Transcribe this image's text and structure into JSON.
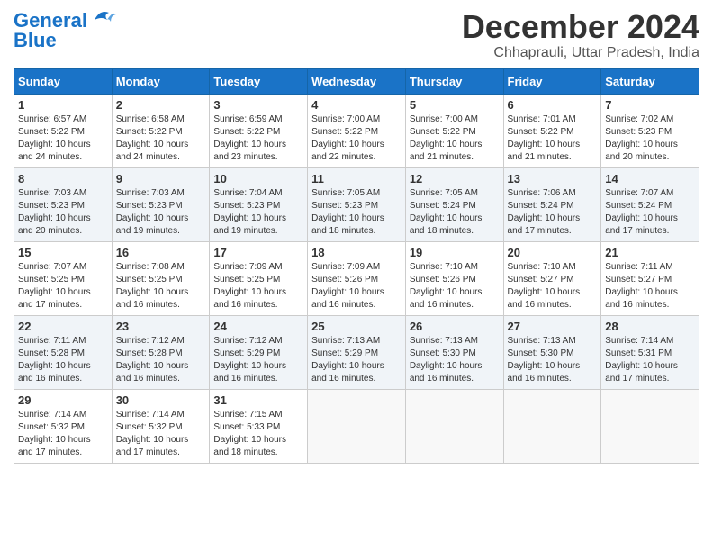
{
  "header": {
    "logo_line1": "General",
    "logo_line2": "Blue",
    "month": "December 2024",
    "location": "Chhaprauli, Uttar Pradesh, India"
  },
  "columns": [
    "Sunday",
    "Monday",
    "Tuesday",
    "Wednesday",
    "Thursday",
    "Friday",
    "Saturday"
  ],
  "weeks": [
    {
      "shaded": false,
      "days": [
        {
          "num": "1",
          "info": "Sunrise: 6:57 AM\nSunset: 5:22 PM\nDaylight: 10 hours\nand 24 minutes."
        },
        {
          "num": "2",
          "info": "Sunrise: 6:58 AM\nSunset: 5:22 PM\nDaylight: 10 hours\nand 24 minutes."
        },
        {
          "num": "3",
          "info": "Sunrise: 6:59 AM\nSunset: 5:22 PM\nDaylight: 10 hours\nand 23 minutes."
        },
        {
          "num": "4",
          "info": "Sunrise: 7:00 AM\nSunset: 5:22 PM\nDaylight: 10 hours\nand 22 minutes."
        },
        {
          "num": "5",
          "info": "Sunrise: 7:00 AM\nSunset: 5:22 PM\nDaylight: 10 hours\nand 21 minutes."
        },
        {
          "num": "6",
          "info": "Sunrise: 7:01 AM\nSunset: 5:22 PM\nDaylight: 10 hours\nand 21 minutes."
        },
        {
          "num": "7",
          "info": "Sunrise: 7:02 AM\nSunset: 5:23 PM\nDaylight: 10 hours\nand 20 minutes."
        }
      ]
    },
    {
      "shaded": true,
      "days": [
        {
          "num": "8",
          "info": "Sunrise: 7:03 AM\nSunset: 5:23 PM\nDaylight: 10 hours\nand 20 minutes."
        },
        {
          "num": "9",
          "info": "Sunrise: 7:03 AM\nSunset: 5:23 PM\nDaylight: 10 hours\nand 19 minutes."
        },
        {
          "num": "10",
          "info": "Sunrise: 7:04 AM\nSunset: 5:23 PM\nDaylight: 10 hours\nand 19 minutes."
        },
        {
          "num": "11",
          "info": "Sunrise: 7:05 AM\nSunset: 5:23 PM\nDaylight: 10 hours\nand 18 minutes."
        },
        {
          "num": "12",
          "info": "Sunrise: 7:05 AM\nSunset: 5:24 PM\nDaylight: 10 hours\nand 18 minutes."
        },
        {
          "num": "13",
          "info": "Sunrise: 7:06 AM\nSunset: 5:24 PM\nDaylight: 10 hours\nand 17 minutes."
        },
        {
          "num": "14",
          "info": "Sunrise: 7:07 AM\nSunset: 5:24 PM\nDaylight: 10 hours\nand 17 minutes."
        }
      ]
    },
    {
      "shaded": false,
      "days": [
        {
          "num": "15",
          "info": "Sunrise: 7:07 AM\nSunset: 5:25 PM\nDaylight: 10 hours\nand 17 minutes."
        },
        {
          "num": "16",
          "info": "Sunrise: 7:08 AM\nSunset: 5:25 PM\nDaylight: 10 hours\nand 16 minutes."
        },
        {
          "num": "17",
          "info": "Sunrise: 7:09 AM\nSunset: 5:25 PM\nDaylight: 10 hours\nand 16 minutes."
        },
        {
          "num": "18",
          "info": "Sunrise: 7:09 AM\nSunset: 5:26 PM\nDaylight: 10 hours\nand 16 minutes."
        },
        {
          "num": "19",
          "info": "Sunrise: 7:10 AM\nSunset: 5:26 PM\nDaylight: 10 hours\nand 16 minutes."
        },
        {
          "num": "20",
          "info": "Sunrise: 7:10 AM\nSunset: 5:27 PM\nDaylight: 10 hours\nand 16 minutes."
        },
        {
          "num": "21",
          "info": "Sunrise: 7:11 AM\nSunset: 5:27 PM\nDaylight: 10 hours\nand 16 minutes."
        }
      ]
    },
    {
      "shaded": true,
      "days": [
        {
          "num": "22",
          "info": "Sunrise: 7:11 AM\nSunset: 5:28 PM\nDaylight: 10 hours\nand 16 minutes."
        },
        {
          "num": "23",
          "info": "Sunrise: 7:12 AM\nSunset: 5:28 PM\nDaylight: 10 hours\nand 16 minutes."
        },
        {
          "num": "24",
          "info": "Sunrise: 7:12 AM\nSunset: 5:29 PM\nDaylight: 10 hours\nand 16 minutes."
        },
        {
          "num": "25",
          "info": "Sunrise: 7:13 AM\nSunset: 5:29 PM\nDaylight: 10 hours\nand 16 minutes."
        },
        {
          "num": "26",
          "info": "Sunrise: 7:13 AM\nSunset: 5:30 PM\nDaylight: 10 hours\nand 16 minutes."
        },
        {
          "num": "27",
          "info": "Sunrise: 7:13 AM\nSunset: 5:30 PM\nDaylight: 10 hours\nand 16 minutes."
        },
        {
          "num": "28",
          "info": "Sunrise: 7:14 AM\nSunset: 5:31 PM\nDaylight: 10 hours\nand 17 minutes."
        }
      ]
    },
    {
      "shaded": false,
      "days": [
        {
          "num": "29",
          "info": "Sunrise: 7:14 AM\nSunset: 5:32 PM\nDaylight: 10 hours\nand 17 minutes."
        },
        {
          "num": "30",
          "info": "Sunrise: 7:14 AM\nSunset: 5:32 PM\nDaylight: 10 hours\nand 17 minutes."
        },
        {
          "num": "31",
          "info": "Sunrise: 7:15 AM\nSunset: 5:33 PM\nDaylight: 10 hours\nand 18 minutes."
        },
        {
          "num": "",
          "info": ""
        },
        {
          "num": "",
          "info": ""
        },
        {
          "num": "",
          "info": ""
        },
        {
          "num": "",
          "info": ""
        }
      ]
    }
  ]
}
